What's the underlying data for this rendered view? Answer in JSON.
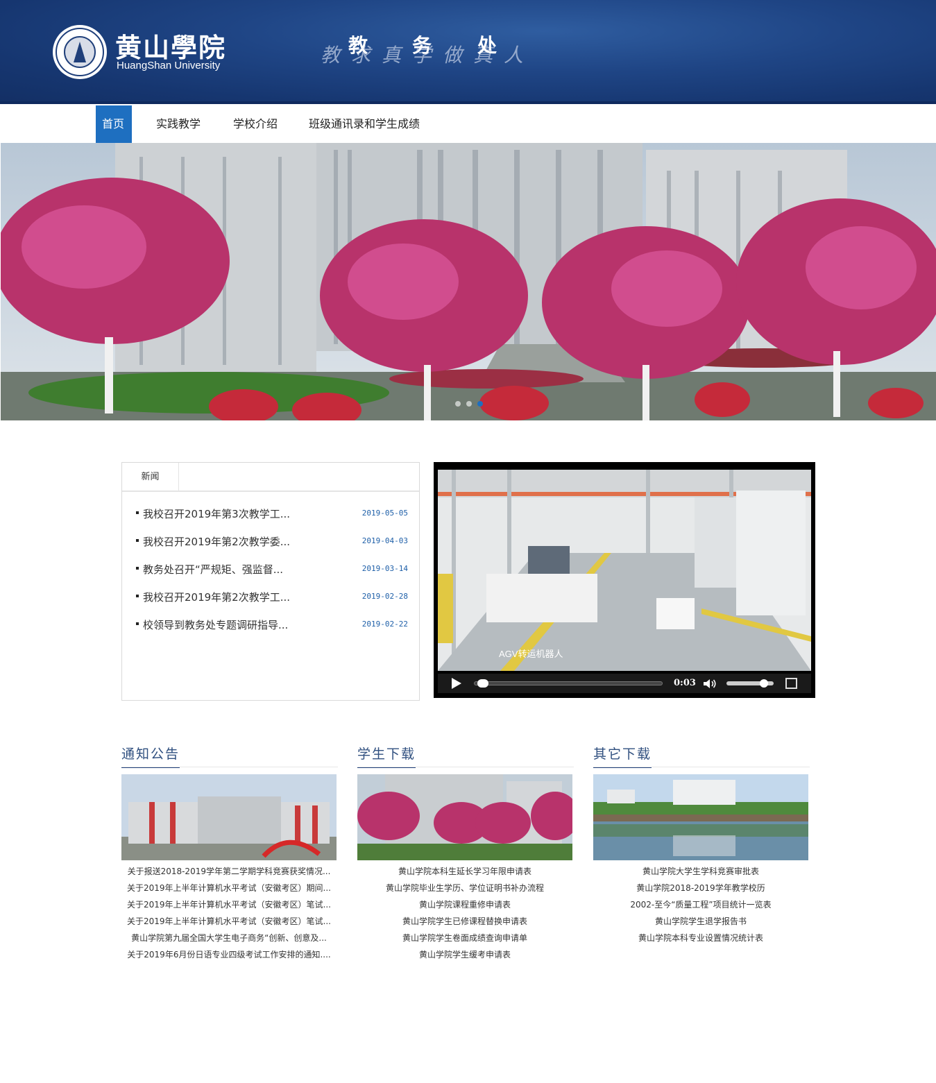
{
  "header": {
    "logo_cn": "黄山學院",
    "logo_en": "HuangShan University",
    "motto": "教求真学做真人",
    "dept_chars": [
      "教",
      "务",
      "处"
    ]
  },
  "nav": {
    "items": [
      {
        "label": "首页",
        "active": true
      },
      {
        "label": "实践教学",
        "active": false
      },
      {
        "label": "学校介绍",
        "active": false
      },
      {
        "label": "班级通讯录和学生成绩",
        "active": false
      }
    ]
  },
  "banner": {
    "slide_count": 3,
    "active_slide": 3
  },
  "news": {
    "tab": "新闻",
    "items": [
      {
        "title": "我校召开2019年第3次教学工...",
        "date": "2019-05-05"
      },
      {
        "title": "我校召开2019年第2次教学委...",
        "date": "2019-04-03"
      },
      {
        "title": "教务处召开“严规矩、强监督...",
        "date": "2019-03-14"
      },
      {
        "title": "我校召开2019年第2次教学工...",
        "date": "2019-02-28"
      },
      {
        "title": "校领导到教务处专题调研指导...",
        "date": "2019-02-22"
      }
    ]
  },
  "video": {
    "caption": "AGV转运机器人",
    "time": "0:03",
    "progress": 0.02,
    "volume": 0.85
  },
  "columns": [
    {
      "title": "通知公告",
      "items": [
        "关于报送2018-2019学年第二学期学科竞赛获奖情况...",
        "关于2019年上半年计算机水平考试（安徽考区）期间...",
        "关于2019年上半年计算机水平考试（安徽考区）笔试...",
        "关于2019年上半年计算机水平考试（安徽考区）笔试...",
        "黄山学院第九届全国大学生电子商务“创新、创意及...",
        "关于2019年6月份日语专业四级考试工作安排的通知...."
      ]
    },
    {
      "title": "学生下载",
      "items": [
        "黄山学院本科生延长学习年限申请表",
        "黄山学院毕业生学历、学位证明书补办流程",
        "黄山学院课程重修申请表",
        "黄山学院学生已修课程替换申请表",
        "黄山学院学生卷面成绩查询申请单",
        "黄山学院学生缓考申请表"
      ]
    },
    {
      "title": "其它下载",
      "items": [
        "黄山学院大学生学科竞赛审批表",
        "黄山学院2018-2019学年教学校历",
        "2002-至今“质量工程”项目统计一览表",
        "黄山学院学生退学报告书",
        "黄山学院本科专业设置情况统计表"
      ]
    }
  ],
  "colors": {
    "header_blue": "#1f4585",
    "nav_active": "#1e6fc0",
    "date_blue": "#1e5fa8",
    "column_title": "#2f4f7f"
  }
}
